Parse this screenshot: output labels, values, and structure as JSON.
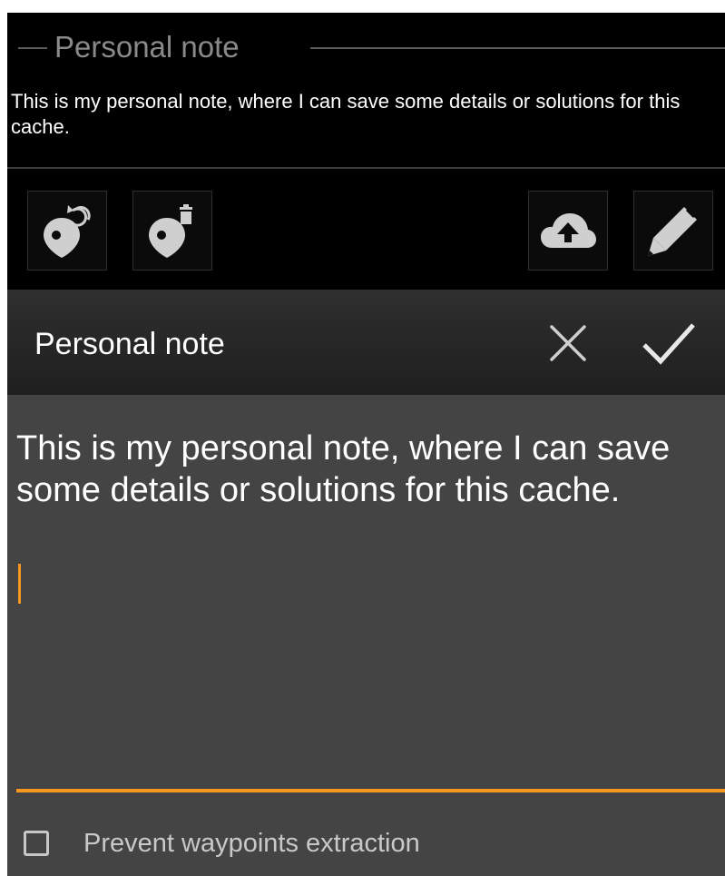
{
  "section": {
    "title": "Personal note",
    "preview_text": "This is my personal note, where I can save some details or solutions for this cache."
  },
  "toolbar": {
    "left_buttons": [
      {
        "icon": "waypoint-refresh-icon"
      },
      {
        "icon": "waypoint-delete-icon"
      }
    ],
    "right_buttons": [
      {
        "icon": "cloud-upload-icon"
      },
      {
        "icon": "pencil-icon"
      }
    ]
  },
  "dialog": {
    "title": "Personal note",
    "cancel_icon": "close-icon",
    "confirm_icon": "checkmark-icon",
    "note_value": "This is my personal note, where I can save some details or solutions for this cache.",
    "checkbox_label": "Prevent waypoints extraction",
    "checkbox_checked": false
  },
  "colors": {
    "accent": "#f5961e",
    "background": "#000000",
    "dialog_body": "#444444",
    "icon_gray": "#cfcfcf"
  }
}
